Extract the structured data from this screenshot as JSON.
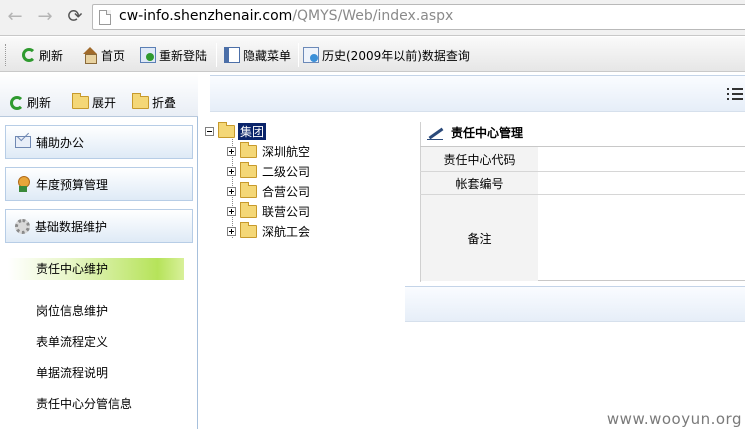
{
  "browser": {
    "url_host": "cw-info.shenzhenair.com",
    "url_path": "/QMYS/Web/index.aspx"
  },
  "toolbar": {
    "refresh": "刷新",
    "home": "首页",
    "relogin": "重新登陆",
    "hide_menu": "隐藏菜单",
    "history": "历史(2009年以前)数据查询"
  },
  "sidebar": {
    "toolbar": {
      "refresh": "刷新",
      "expand": "展开",
      "collapse": "折叠"
    },
    "headers": [
      "辅助办公",
      "年度预算管理",
      "基础数据维护"
    ],
    "items": [
      "责任中心维护",
      "岗位信息维护",
      "表单流程定义",
      "单据流程说明",
      "责任中心分管信息"
    ],
    "active_item": "责任中心维护"
  },
  "tree": {
    "root": "集团",
    "children": [
      "深圳航空",
      "二级公司",
      "合营公司",
      "联营公司",
      "深航工会"
    ]
  },
  "form": {
    "title": "责任中心管理",
    "fields": [
      "责任中心代码",
      "帐套编号",
      "备注"
    ]
  },
  "watermark": "www.wooyun.org",
  "colors": {
    "accent": "#b6e35a",
    "selection": "#0a246a",
    "panel_border": "#a7c0dc"
  }
}
